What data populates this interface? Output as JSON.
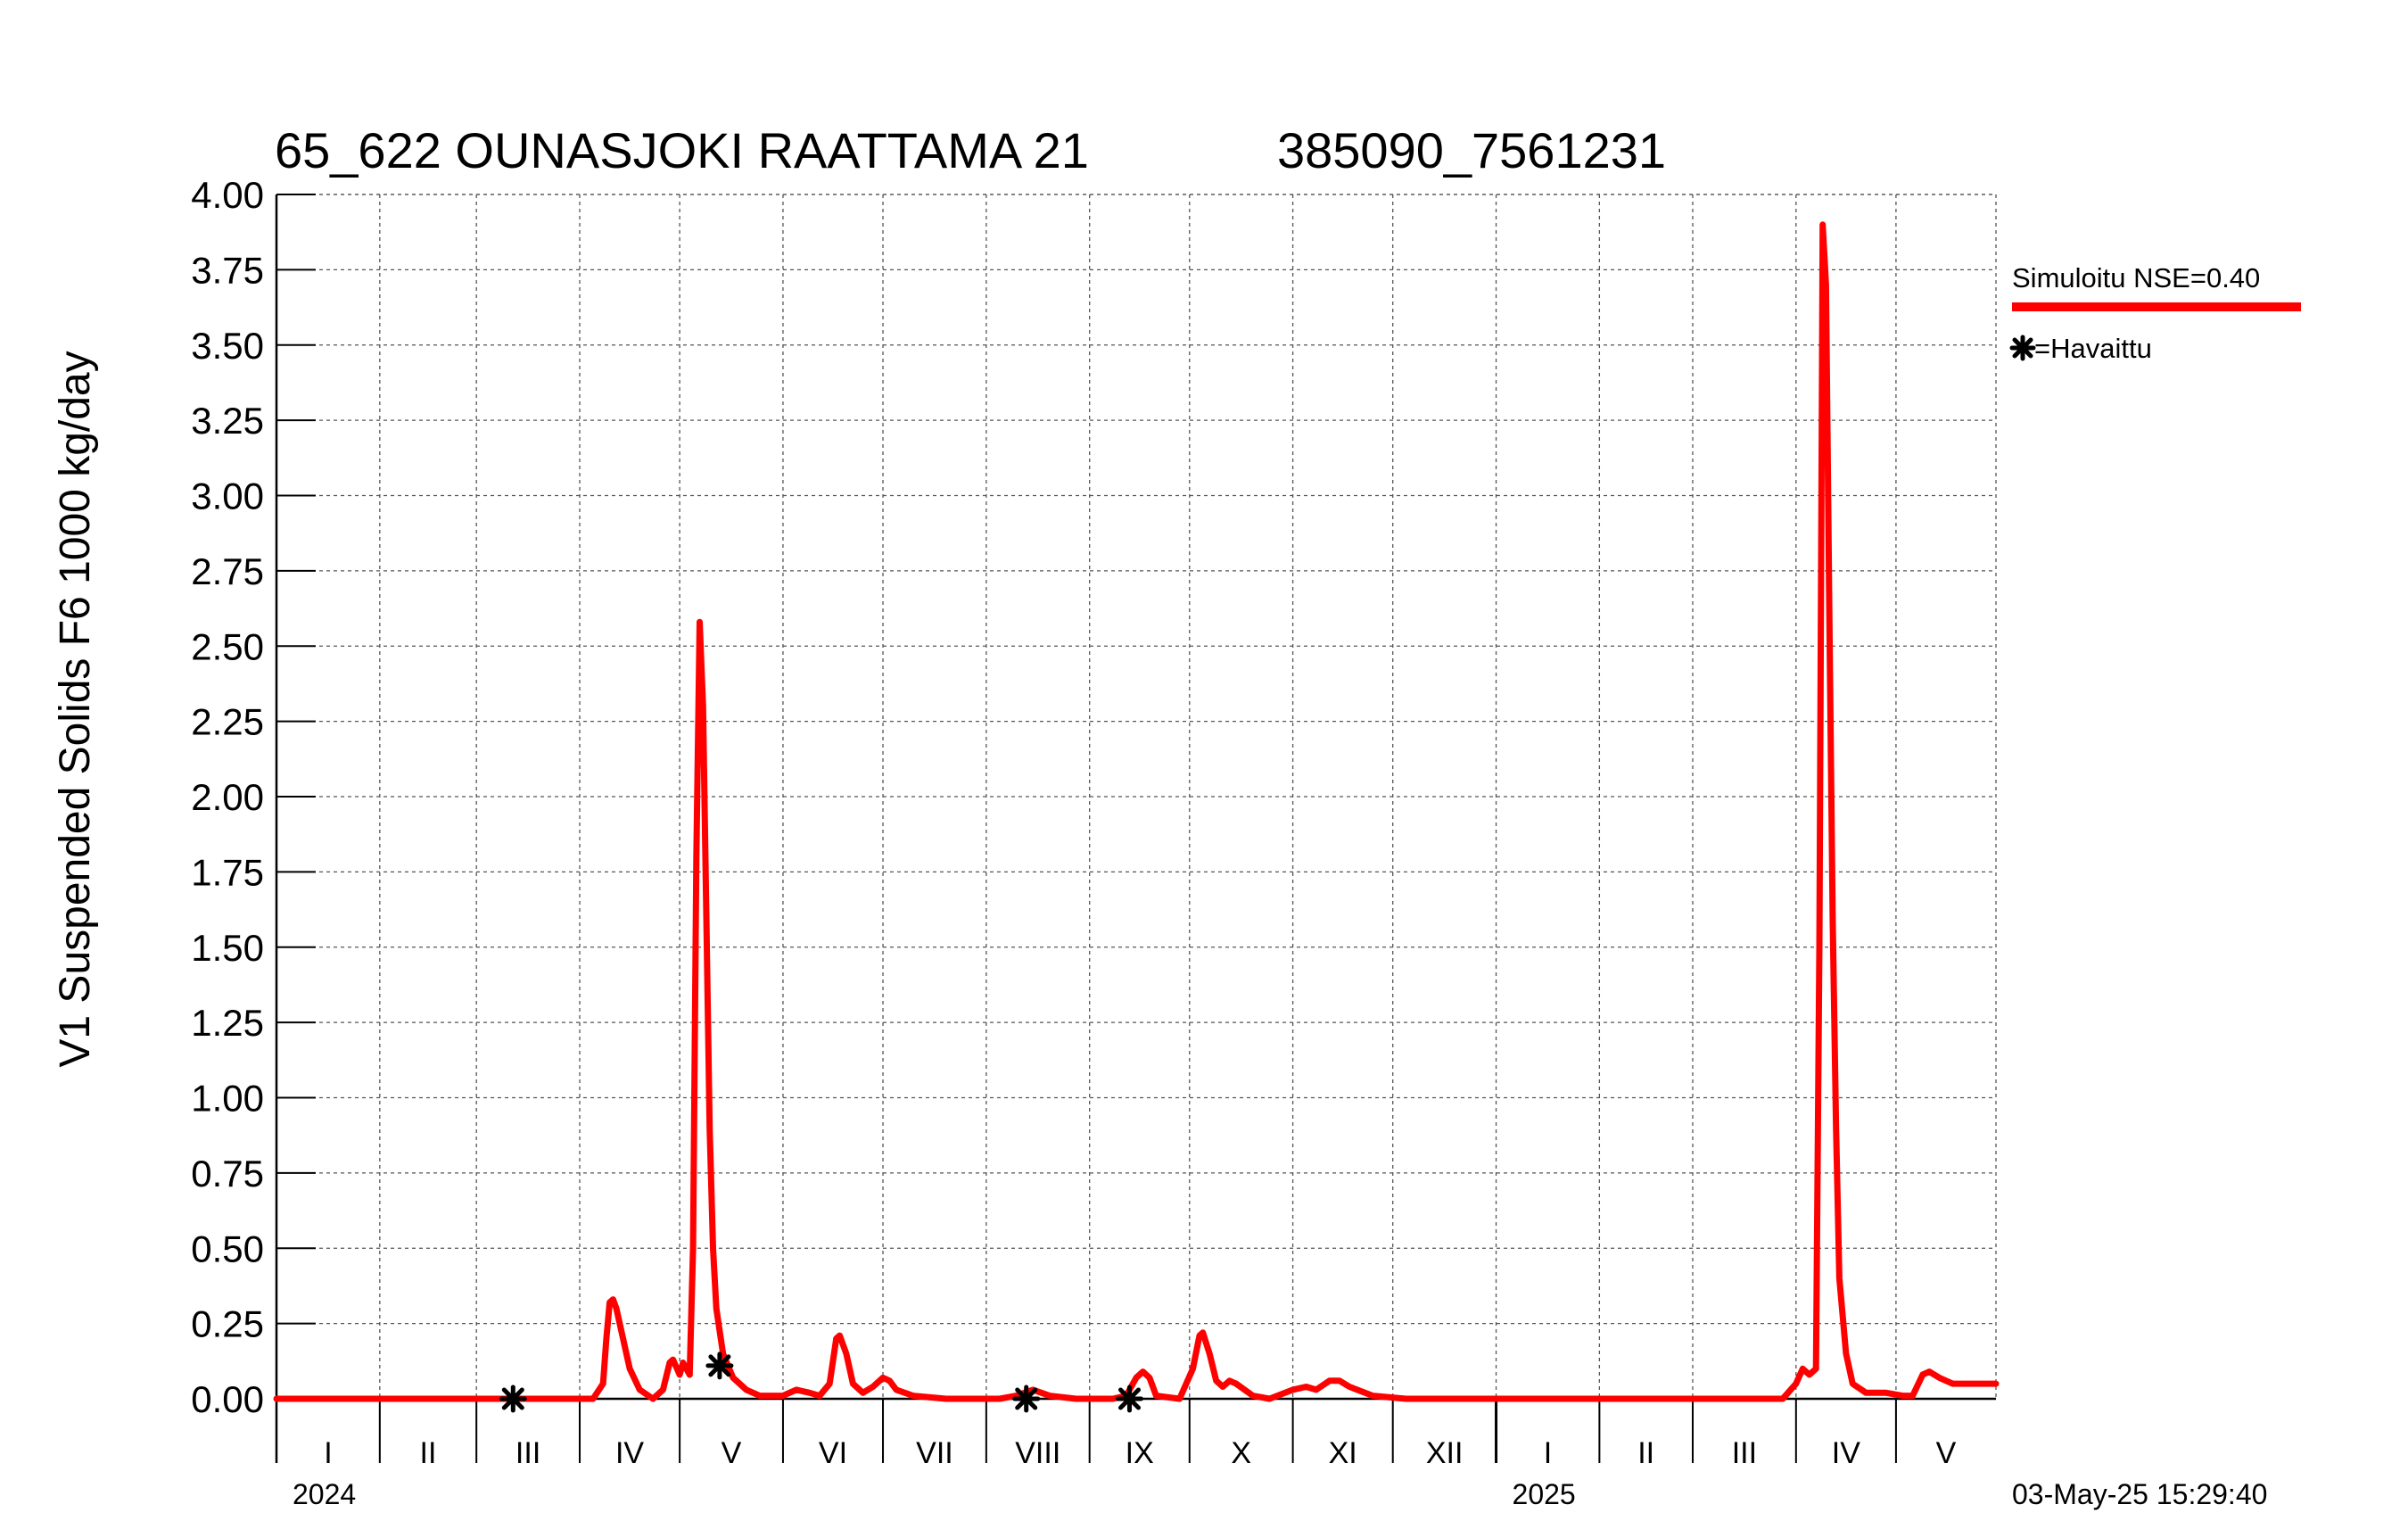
{
  "chart_data": {
    "type": "line",
    "title": "65_622 OUNASJOKI RAATTAMA 21",
    "subtitle": "385090_7561231",
    "ylabel": "V1 Suspended Solids F6 1000 kg/day",
    "xlabel": "",
    "ylim": [
      0,
      4.0
    ],
    "xlim": [
      "2024-01-01",
      "2025-05-31"
    ],
    "grid": true,
    "legend_position": "right",
    "yticks": [
      "0.00",
      "0.25",
      "0.50",
      "0.75",
      "1.00",
      "1.25",
      "1.50",
      "1.75",
      "2.00",
      "2.25",
      "2.50",
      "2.75",
      "3.00",
      "3.25",
      "3.50",
      "3.75",
      "4.00"
    ],
    "month_ticks": [
      {
        "label": "I",
        "date": "2024-01-01"
      },
      {
        "label": "II",
        "date": "2024-02-01"
      },
      {
        "label": "III",
        "date": "2024-03-01"
      },
      {
        "label": "IV",
        "date": "2024-04-01"
      },
      {
        "label": "V",
        "date": "2024-05-01"
      },
      {
        "label": "VI",
        "date": "2024-06-01"
      },
      {
        "label": "VII",
        "date": "2024-07-01"
      },
      {
        "label": "VIII",
        "date": "2024-08-01"
      },
      {
        "label": "IX",
        "date": "2024-09-01"
      },
      {
        "label": "X",
        "date": "2024-10-01"
      },
      {
        "label": "XI",
        "date": "2024-11-01"
      },
      {
        "label": "XII",
        "date": "2024-12-01"
      },
      {
        "label": "I",
        "date": "2025-01-01"
      },
      {
        "label": "II",
        "date": "2025-02-01"
      },
      {
        "label": "III",
        "date": "2025-03-01"
      },
      {
        "label": "IV",
        "date": "2025-04-01"
      },
      {
        "label": "V",
        "date": "2025-05-01"
      }
    ],
    "year_labels": [
      {
        "label": "2024",
        "date": "2024-01-01"
      },
      {
        "label": "2025",
        "date": "2025-01-01"
      }
    ],
    "series": [
      {
        "name": "Simuloitu NSE=0.40",
        "color": "#ff0000",
        "style": "line",
        "points": [
          [
            "2024-01-01",
            0.0
          ],
          [
            "2024-03-15",
            0.0
          ],
          [
            "2024-04-05",
            0.0
          ],
          [
            "2024-04-08",
            0.05
          ],
          [
            "2024-04-09",
            0.2
          ],
          [
            "2024-04-10",
            0.32
          ],
          [
            "2024-04-11",
            0.33
          ],
          [
            "2024-04-12",
            0.3
          ],
          [
            "2024-04-14",
            0.2
          ],
          [
            "2024-04-16",
            0.1
          ],
          [
            "2024-04-19",
            0.03
          ],
          [
            "2024-04-23",
            0.0
          ],
          [
            "2024-04-26",
            0.03
          ],
          [
            "2024-04-28",
            0.12
          ],
          [
            "2024-04-29",
            0.13
          ],
          [
            "2024-05-01",
            0.08
          ],
          [
            "2024-05-02",
            0.12
          ],
          [
            "2024-05-03",
            0.1
          ],
          [
            "2024-05-04",
            0.08
          ],
          [
            "2024-05-05",
            0.5
          ],
          [
            "2024-05-06",
            1.8
          ],
          [
            "2024-05-07",
            2.58
          ],
          [
            "2024-05-08",
            2.3
          ],
          [
            "2024-05-09",
            1.6
          ],
          [
            "2024-05-10",
            0.9
          ],
          [
            "2024-05-11",
            0.5
          ],
          [
            "2024-05-12",
            0.3
          ],
          [
            "2024-05-14",
            0.15
          ],
          [
            "2024-05-17",
            0.07
          ],
          [
            "2024-05-21",
            0.03
          ],
          [
            "2024-05-25",
            0.01
          ],
          [
            "2024-06-01",
            0.01
          ],
          [
            "2024-06-05",
            0.03
          ],
          [
            "2024-06-09",
            0.02
          ],
          [
            "2024-06-12",
            0.01
          ],
          [
            "2024-06-15",
            0.05
          ],
          [
            "2024-06-17",
            0.2
          ],
          [
            "2024-06-18",
            0.21
          ],
          [
            "2024-06-20",
            0.15
          ],
          [
            "2024-06-22",
            0.05
          ],
          [
            "2024-06-25",
            0.02
          ],
          [
            "2024-06-28",
            0.04
          ],
          [
            "2024-07-01",
            0.07
          ],
          [
            "2024-07-03",
            0.06
          ],
          [
            "2024-07-05",
            0.03
          ],
          [
            "2024-07-10",
            0.01
          ],
          [
            "2024-07-20",
            0.0
          ],
          [
            "2024-08-05",
            0.0
          ],
          [
            "2024-08-10",
            0.01
          ],
          [
            "2024-08-15",
            0.03
          ],
          [
            "2024-08-20",
            0.01
          ],
          [
            "2024-08-28",
            0.0
          ],
          [
            "2024-09-08",
            0.0
          ],
          [
            "2024-09-12",
            0.01
          ],
          [
            "2024-09-15",
            0.07
          ],
          [
            "2024-09-17",
            0.09
          ],
          [
            "2024-09-19",
            0.07
          ],
          [
            "2024-09-21",
            0.01
          ],
          [
            "2024-09-28",
            0.0
          ],
          [
            "2024-10-02",
            0.1
          ],
          [
            "2024-10-04",
            0.21
          ],
          [
            "2024-10-05",
            0.22
          ],
          [
            "2024-10-07",
            0.15
          ],
          [
            "2024-10-09",
            0.06
          ],
          [
            "2024-10-11",
            0.04
          ],
          [
            "2024-10-13",
            0.06
          ],
          [
            "2024-10-15",
            0.05
          ],
          [
            "2024-10-20",
            0.01
          ],
          [
            "2024-10-25",
            0.0
          ],
          [
            "2024-11-01",
            0.03
          ],
          [
            "2024-11-05",
            0.04
          ],
          [
            "2024-11-08",
            0.03
          ],
          [
            "2024-11-12",
            0.06
          ],
          [
            "2024-11-15",
            0.06
          ],
          [
            "2024-11-18",
            0.04
          ],
          [
            "2024-11-25",
            0.01
          ],
          [
            "2024-12-05",
            0.0
          ],
          [
            "2025-01-01",
            0.0
          ],
          [
            "2025-02-01",
            0.0
          ],
          [
            "2025-03-01",
            0.0
          ],
          [
            "2025-03-28",
            0.0
          ],
          [
            "2025-04-01",
            0.05
          ],
          [
            "2025-04-03",
            0.1
          ],
          [
            "2025-04-05",
            0.08
          ],
          [
            "2025-04-07",
            0.1
          ],
          [
            "2025-04-08",
            1.5
          ],
          [
            "2025-04-09",
            3.9
          ],
          [
            "2025-04-10",
            3.7
          ],
          [
            "2025-04-11",
            2.6
          ],
          [
            "2025-04-12",
            1.6
          ],
          [
            "2025-04-13",
            0.9
          ],
          [
            "2025-04-14",
            0.4
          ],
          [
            "2025-04-16",
            0.15
          ],
          [
            "2025-04-18",
            0.05
          ],
          [
            "2025-04-22",
            0.02
          ],
          [
            "2025-04-28",
            0.02
          ],
          [
            "2025-05-03",
            0.01
          ],
          [
            "2025-05-06",
            0.01
          ],
          [
            "2025-05-09",
            0.08
          ],
          [
            "2025-05-11",
            0.09
          ],
          [
            "2025-05-14",
            0.07
          ],
          [
            "2025-05-18",
            0.05
          ],
          [
            "2025-05-24",
            0.05
          ],
          [
            "2025-05-31",
            0.05
          ]
        ]
      },
      {
        "name": "=Havaittu",
        "color": "#000000",
        "style": "marker",
        "points": [
          [
            "2024-03-12",
            0.0
          ],
          [
            "2024-05-13",
            0.11
          ],
          [
            "2024-08-13",
            0.0
          ],
          [
            "2024-09-13",
            0.0
          ]
        ]
      }
    ],
    "timestamp": "03-May-25 15:29:40"
  }
}
